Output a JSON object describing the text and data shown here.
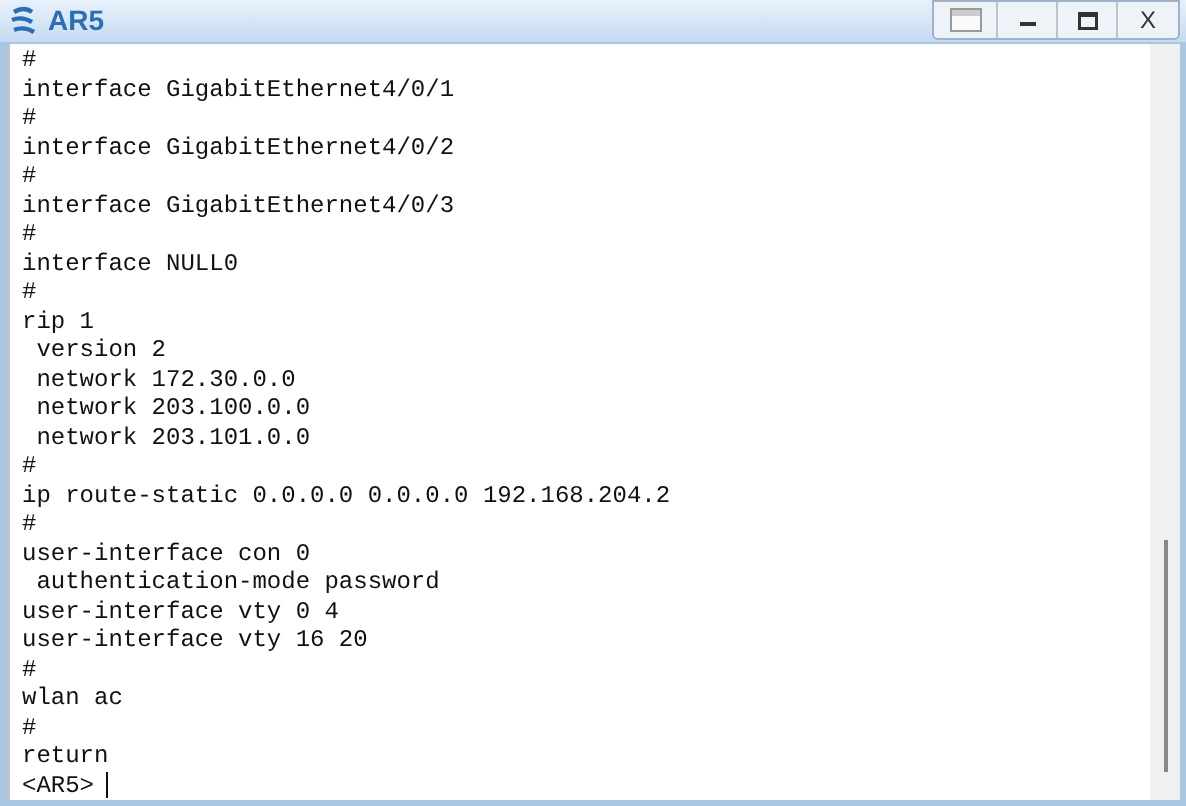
{
  "window": {
    "title": "AR5",
    "close_label": "X"
  },
  "terminal": {
    "lines": [
      "#",
      "interface GigabitEthernet4/0/1",
      "#",
      "interface GigabitEthernet4/0/2",
      "#",
      "interface GigabitEthernet4/0/3",
      "#",
      "interface NULL0",
      "#",
      "rip 1",
      " version 2",
      " network 172.30.0.0",
      " network 203.100.0.0",
      " network 203.101.0.0",
      "#",
      "ip route-static 0.0.0.0 0.0.0.0 192.168.204.2",
      "#",
      "user-interface con 0",
      " authentication-mode password",
      "user-interface vty 0 4",
      "user-interface vty 16 20",
      "#",
      "wlan ac",
      "#",
      "return"
    ],
    "prompt": "<AR5>"
  }
}
